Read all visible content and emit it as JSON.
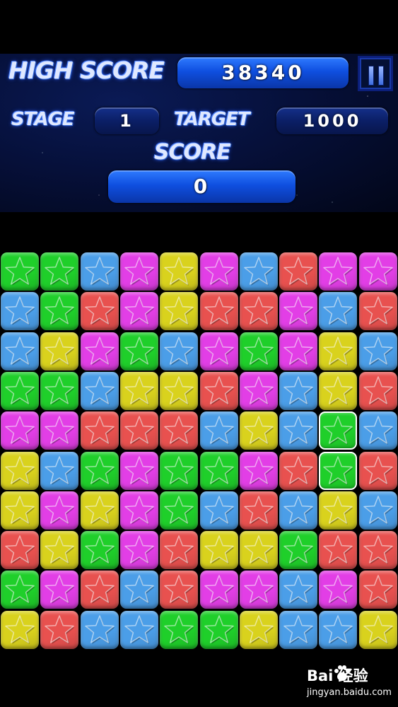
{
  "hud": {
    "high_score_label": "HIGH SCORE",
    "high_score_value": "38340",
    "stage_label": "STAGE",
    "stage_value": "1",
    "target_label": "TARGET",
    "target_value": "1000",
    "score_label": "SCORE",
    "score_value": "0"
  },
  "colors": {
    "G": "#1fcf2a",
    "B": "#4b9ee8",
    "M": "#e23ee6",
    "Y": "#d9d21d",
    "R": "#e8514f"
  },
  "board": {
    "columns": 10,
    "rows": [
      [
        "G",
        "G",
        "B",
        "M",
        "Y",
        "M",
        "B",
        "R",
        "M",
        "M"
      ],
      [
        "B",
        "G",
        "R",
        "M",
        "Y",
        "R",
        "R",
        "M",
        "B",
        "R"
      ],
      [
        "B",
        "Y",
        "M",
        "G",
        "B",
        "M",
        "G",
        "M",
        "Y",
        "B"
      ],
      [
        "G",
        "G",
        "B",
        "Y",
        "Y",
        "R",
        "M",
        "B",
        "Y",
        "R"
      ],
      [
        "M",
        "M",
        "R",
        "R",
        "R",
        "B",
        "Y",
        "B",
        "G",
        "B"
      ],
      [
        "Y",
        "B",
        "G",
        "M",
        "G",
        "G",
        "M",
        "R",
        "G",
        "R"
      ],
      [
        "Y",
        "M",
        "Y",
        "M",
        "G",
        "B",
        "R",
        "B",
        "Y",
        "B"
      ],
      [
        "R",
        "Y",
        "G",
        "M",
        "R",
        "Y",
        "Y",
        "G",
        "R",
        "R"
      ],
      [
        "G",
        "M",
        "R",
        "B",
        "R",
        "M",
        "M",
        "B",
        "M",
        "R"
      ],
      [
        "Y",
        "R",
        "B",
        "B",
        "G",
        "G",
        "Y",
        "B",
        "B",
        "Y"
      ]
    ],
    "selected": [
      [
        4,
        8
      ],
      [
        5,
        8
      ]
    ]
  },
  "watermark": {
    "brand": "Bai  经验",
    "site": "jingyan.baidu.com",
    "icon": "paw-icon"
  }
}
